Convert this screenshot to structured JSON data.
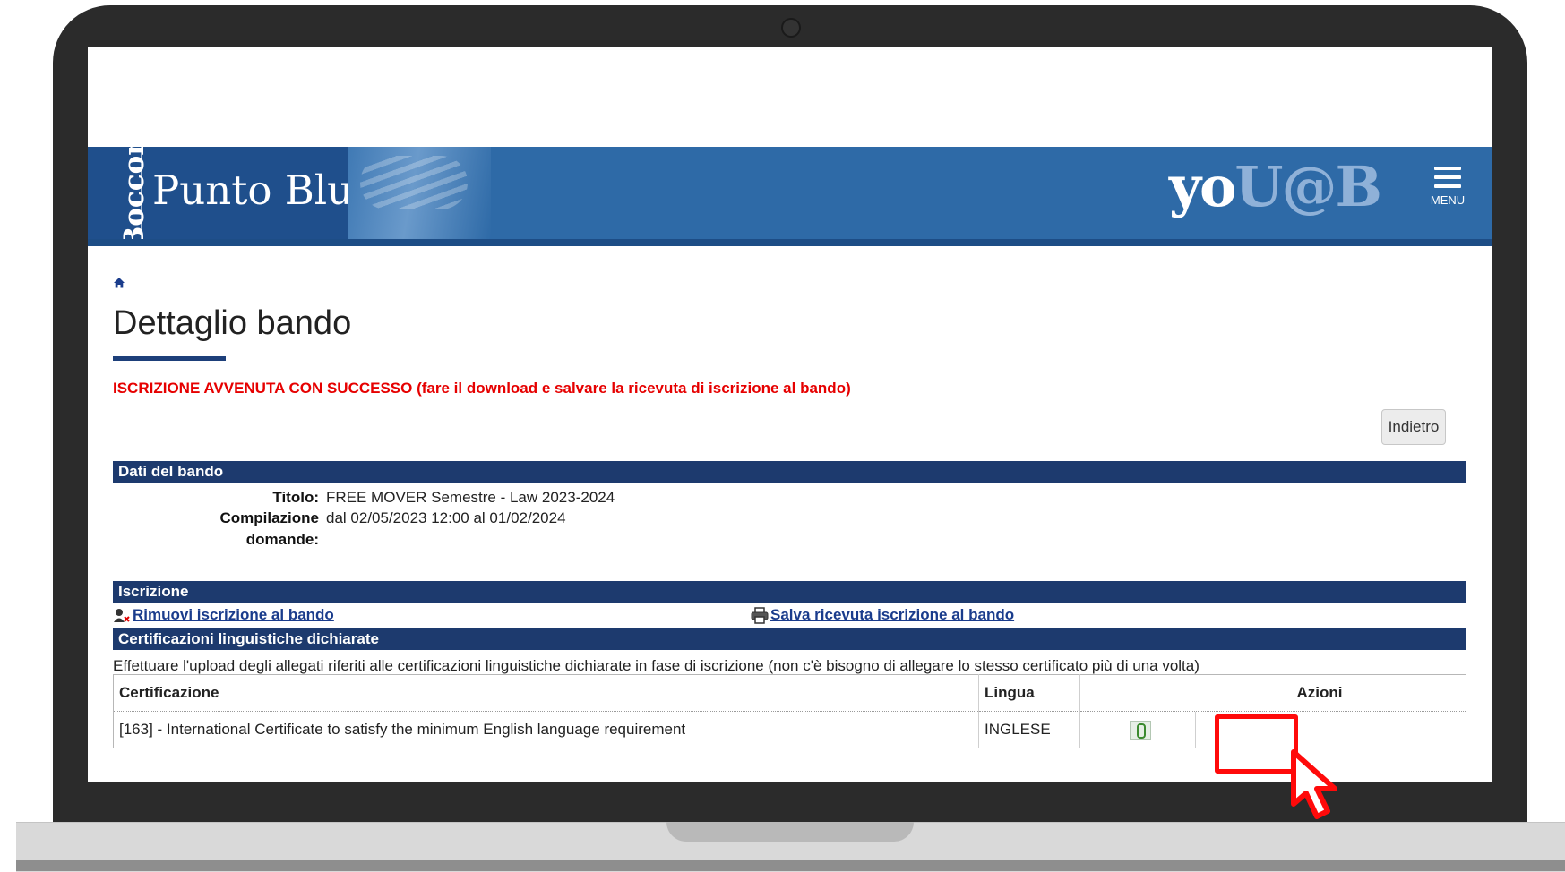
{
  "header": {
    "brand_vertical": "Bocconi",
    "brand_name": "Punto Blu",
    "logo_part1": "yo",
    "logo_part2": "U@B",
    "menu_label": "MENU"
  },
  "page": {
    "title": "Dettaglio bando",
    "success_message": "ISCRIZIONE AVVENUTA CON SUCCESSO (fare il download e salvare la ricevuta di iscrizione al bando)",
    "back_button": "Indietro"
  },
  "dati_bando": {
    "section_title": "Dati del bando",
    "titolo_label": "Titolo:",
    "titolo_value": "FREE MOVER Semestre - Law 2023-2024",
    "compilazione_label": "Compilazione",
    "compilazione_value": "dal 02/05/2023 12:00 al 01/02/2024",
    "domande_label": "domande:"
  },
  "iscrizione": {
    "section_title": "Iscrizione",
    "remove_link": "Rimuovi iscrizione al bando",
    "save_link": "Salva ricevuta iscrizione al bando"
  },
  "certificazioni": {
    "section_title": "Certificazioni linguistiche dichiarate",
    "description": "Effettuare l'upload degli allegati riferiti alle certificazioni linguistiche dichiarate in fase di iscrizione (non c'è bisogno di allegare lo stesso certificato più di una volta)",
    "columns": {
      "certificazione": "Certificazione",
      "lingua": "Lingua",
      "azioni": "Azioni"
    },
    "rows": [
      {
        "certificazione": "[163] - International Certificate to satisfy the minimum English language requirement",
        "lingua": "INGLESE",
        "action_icon": "attach-icon"
      }
    ]
  },
  "colors": {
    "header_blue": "#2e6aa7",
    "section_navy": "#1d3a6e",
    "success_red": "#e60000",
    "highlight_red": "#ff0a0a"
  }
}
